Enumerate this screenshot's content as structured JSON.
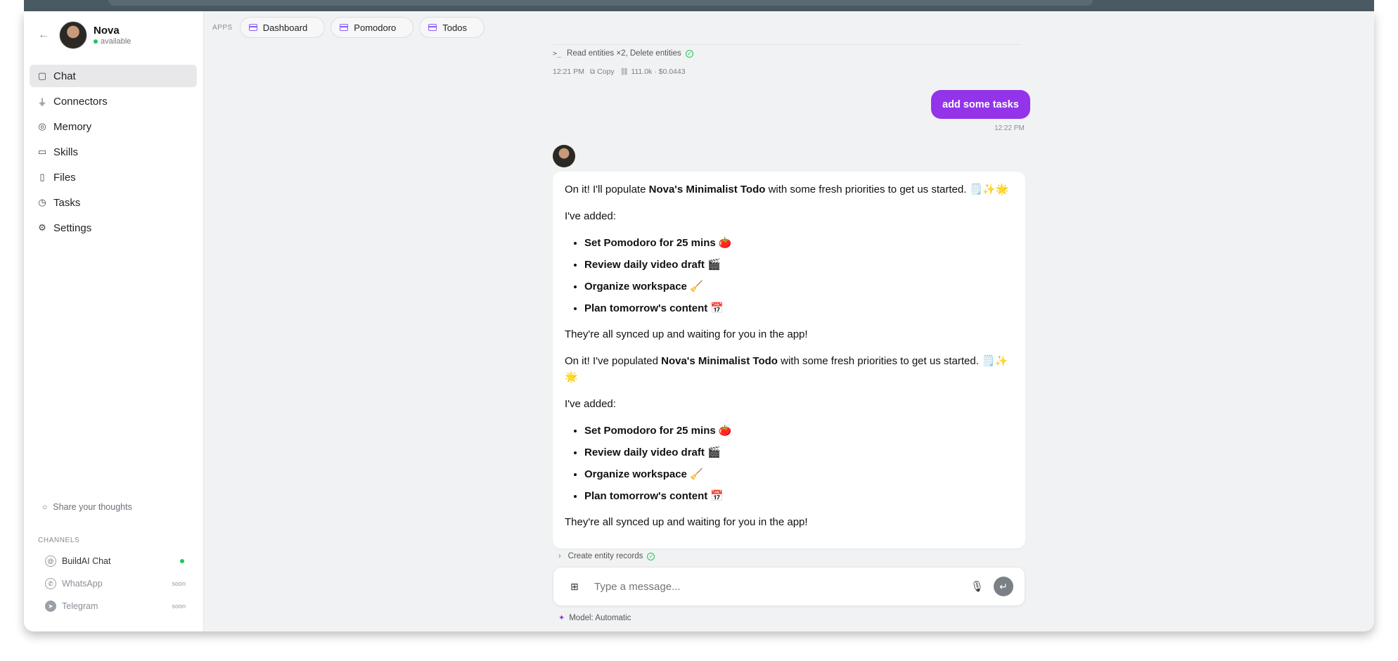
{
  "profile": {
    "name": "Nova",
    "status": "available"
  },
  "sidebar": {
    "items": [
      {
        "label": "Chat",
        "icon": "chat-bubble-icon"
      },
      {
        "label": "Connectors",
        "icon": "plug-icon"
      },
      {
        "label": "Memory",
        "icon": "brain-icon"
      },
      {
        "label": "Skills",
        "icon": "book-icon"
      },
      {
        "label": "Files",
        "icon": "file-icon"
      },
      {
        "label": "Tasks",
        "icon": "clock-icon"
      },
      {
        "label": "Settings",
        "icon": "gear-icon"
      }
    ],
    "share": "Share your thoughts",
    "channels_heading": "CHANNELS",
    "channels": [
      {
        "label": "BuildAI Chat",
        "status": ""
      },
      {
        "label": "WhatsApp",
        "status": "soon"
      },
      {
        "label": "Telegram",
        "status": "soon"
      }
    ]
  },
  "apps": {
    "label": "APPS",
    "chips": [
      "Dashboard",
      "Pomodoro",
      "Todos"
    ]
  },
  "thread": {
    "tool_summary": "Read entities ×2, Delete entities",
    "prompt_symbol": ">_",
    "meta_time": "12:21 PM",
    "meta_copy": "Copy",
    "meta_usage": "111.0k · $0.0443",
    "user_message": "add some tasks",
    "user_time": "12:22 PM",
    "reply": {
      "p1_a": "On it! I'll populate ",
      "p1_b": "Nova's Minimalist Todo",
      "p1_c": " with some fresh priorities to get us started. 🗒️✨🌟",
      "added": "I've added:",
      "tasks": [
        "Set Pomodoro for 25 mins 🍅",
        "Review daily video draft 🎬",
        "Organize workspace 🧹",
        "Plan tomorrow's content 📅"
      ],
      "synced": "They're all synced up and waiting for you in the app!",
      "p2_a": "On it! I've populated ",
      "p2_b": "Nova's Minimalist Todo",
      "p2_c": " with some fresh priorities to get us started. 🗒️✨🌟"
    },
    "create_line": "Create entity records"
  },
  "composer": {
    "placeholder": "Type a message..."
  },
  "model": "Model: Automatic",
  "colors": {
    "accent": "#9333ea",
    "online": "#22c55e"
  }
}
